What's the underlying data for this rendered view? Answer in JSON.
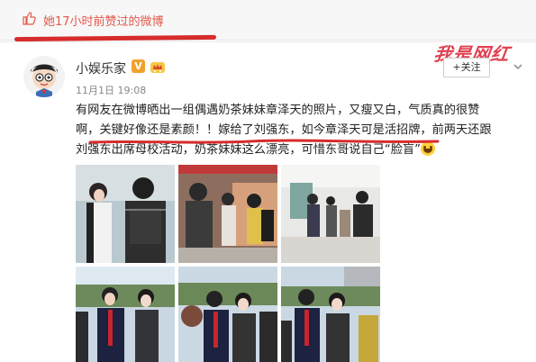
{
  "header": {
    "liked_text": "她17小时前赞过的微博"
  },
  "post": {
    "username": "小娱乐家",
    "verified_badge": "V",
    "timestamp": "11月1日 19:08",
    "follow_label": "+关注",
    "watermark": "我是网红",
    "lines": [
      "有网友在微博晒出一组偶遇奶茶妹妹章泽天的照片，又瘦又白，气质真的很赞",
      "啊，关键好像还是素颜！！嫁给了刘强东，如今章泽天可是活招牌，前两天还跟",
      "刘强东出席母校活动，奶茶妹妹这么漂亮，可惜东哥说自己“脸盲”"
    ]
  },
  "photos": {
    "count": 6,
    "accent_red": "#d72c2c",
    "icon_like": "thumbs-up-icon",
    "icon_crown": "crown-icon",
    "icon_emoji": "laughing-emoji-icon"
  }
}
